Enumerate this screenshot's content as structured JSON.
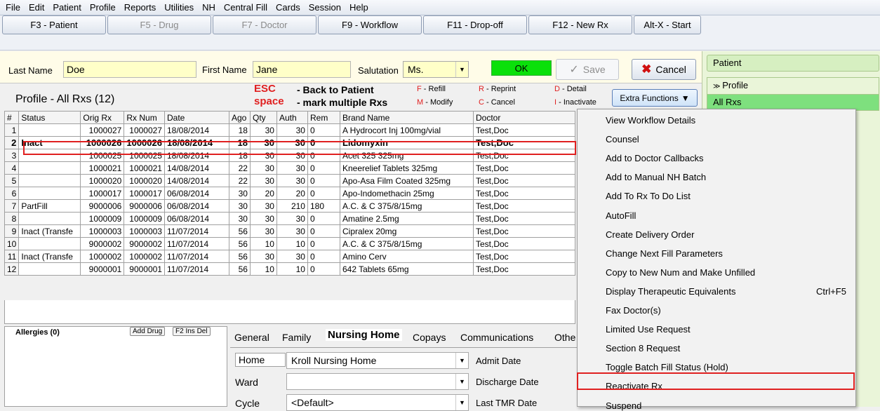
{
  "menu": [
    "File",
    "Edit",
    "Patient",
    "Profile",
    "Reports",
    "Utilities",
    "NH",
    "Central Fill",
    "Cards",
    "Session",
    "Help"
  ],
  "fkeys": [
    "F3 - Patient",
    "F5 - Drug",
    "F7 - Doctor",
    "F9 - Workflow",
    "F11 - Drop-off",
    "F12 - New Rx",
    "Alt-X - Start"
  ],
  "patient": {
    "last_label": "Last Name",
    "last": "Doe",
    "first_label": "First Name",
    "first": "Jane",
    "sal_label": "Salutation",
    "sal": "Ms."
  },
  "buttons": {
    "ok": "OK",
    "save": "Save",
    "cancel": "Cancel",
    "extra": "Extra Functions"
  },
  "profile": {
    "title": "Profile - All Rxs (12)",
    "esc": "ESC",
    "esc_desc": "- Back to Patient",
    "space": "space",
    "space_desc": "- mark multiple Rxs",
    "k1": "F",
    "k1d": " - Refill",
    "k2": "M",
    "k2d": " - Modify",
    "k3": "R",
    "k3d": " - Reprint",
    "k4": "C",
    "k4d": " - Cancel",
    "k5": "D",
    "k5d": " - Detail",
    "k6": "I",
    "k6d": " - Inactivate"
  },
  "right": {
    "patient": "Patient",
    "profile": "Profile",
    "allrxs": "All Rxs"
  },
  "columns": [
    "#",
    "Status",
    "Orig Rx",
    "Rx Num",
    "Date",
    "Ago",
    "Qty",
    "Auth",
    "Rem",
    "Brand Name",
    "Doctor"
  ],
  "rows": [
    [
      "1",
      "",
      "1000027",
      "1000027",
      "18/08/2014",
      "18",
      "30",
      "30",
      "0",
      "A Hydrocort Inj 100mg/vial",
      "Test,Doc"
    ],
    [
      "2",
      "Inact",
      "1000026",
      "1000026",
      "18/08/2014",
      "18",
      "30",
      "30",
      "0",
      "Lidomyxin",
      "Test,Doc"
    ],
    [
      "3",
      "",
      "1000025",
      "1000025",
      "18/08/2014",
      "18",
      "30",
      "30",
      "0",
      "Acet 325 325mg",
      "Test,Doc"
    ],
    [
      "4",
      "",
      "1000021",
      "1000021",
      "14/08/2014",
      "22",
      "30",
      "30",
      "0",
      "Kneerelief Tablets 325mg",
      "Test,Doc"
    ],
    [
      "5",
      "",
      "1000020",
      "1000020",
      "14/08/2014",
      "22",
      "30",
      "30",
      "0",
      "Apo-Asa Film Coated 325mg",
      "Test,Doc"
    ],
    [
      "6",
      "",
      "1000017",
      "1000017",
      "06/08/2014",
      "30",
      "20",
      "20",
      "0",
      "Apo-Indomethacin 25mg",
      "Test,Doc"
    ],
    [
      "7",
      "PartFill",
      "9000006",
      "9000006",
      "06/08/2014",
      "30",
      "30",
      "210",
      "180",
      "A.C. & C 375/8/15mg",
      "Test,Doc"
    ],
    [
      "8",
      "",
      "1000009",
      "1000009",
      "06/08/2014",
      "30",
      "30",
      "30",
      "0",
      "Amatine 2.5mg",
      "Test,Doc"
    ],
    [
      "9",
      "Inact (Transfe",
      "1000003",
      "1000003",
      "11/07/2014",
      "56",
      "30",
      "30",
      "0",
      "Cipralex 20mg",
      "Test,Doc"
    ],
    [
      "10",
      "",
      "9000002",
      "9000002",
      "11/07/2014",
      "56",
      "10",
      "10",
      "0",
      "A.C. & C 375/8/15mg",
      "Test,Doc"
    ],
    [
      "11",
      "Inact (Transfe",
      "1000002",
      "1000002",
      "11/07/2014",
      "56",
      "30",
      "30",
      "0",
      "Amino Cerv",
      "Test,Doc"
    ],
    [
      "12",
      "",
      "9000001",
      "9000001",
      "11/07/2014",
      "56",
      "10",
      "10",
      "0",
      "642 Tablets 65mg",
      "Test,Doc"
    ]
  ],
  "allergies": {
    "label": "Allergies (0)",
    "add": "Add Drug",
    "keys": "F2 Ins Del"
  },
  "tabs": [
    "General",
    "Family",
    "Nursing Home",
    "Copays",
    "Communications",
    "Othe"
  ],
  "nh": {
    "home_label": "Home",
    "home": "Kroll Nursing Home",
    "ward_label": "Ward",
    "ward": "",
    "cycle_label": "Cycle",
    "cycle": "<Default>",
    "admit": "Admit Date",
    "discharge": "Discharge Date",
    "tmr": "Last TMR Date"
  },
  "menu_items": [
    "View Workflow Details",
    "Counsel",
    "Add to Doctor Callbacks",
    "Add to Manual NH Batch",
    "Add To Rx To Do List",
    "AutoFill",
    "Create Delivery Order",
    "Change Next Fill Parameters",
    "Copy to New Num and Make Unfilled",
    "Display Therapeutic Equivalents",
    "Fax Doctor(s)",
    "Limited Use Request",
    "Section 8 Request",
    "Toggle Batch Fill Status (Hold)",
    "Reactivate Rx",
    "Suspend"
  ],
  "shortcut": "Ctrl+F5",
  "colors": {
    "ok": "#0ae00a",
    "highlight": "#e02020",
    "field": "#ffffc8",
    "panel": "#d6efc1"
  }
}
